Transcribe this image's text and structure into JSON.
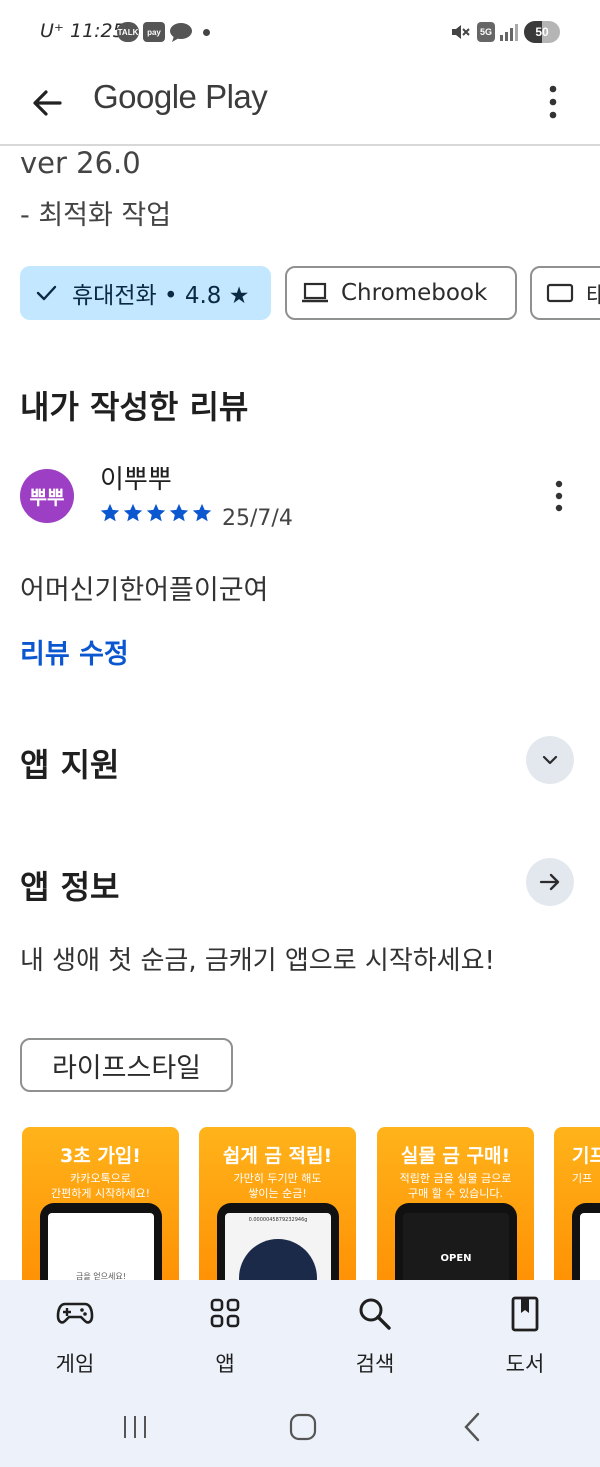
{
  "status_bar": {
    "carrier_time": "U⁺ 11:25",
    "notifications": [
      "TALK",
      "pay"
    ],
    "network": "5G",
    "battery": 50,
    "battery_label": "50"
  },
  "app_bar": {
    "title": "Google Play"
  },
  "whats_new": {
    "version": "ver 26.0",
    "note": "- 최적화 작업"
  },
  "device_chips": [
    {
      "label": "휴대전화 • 4.8 ★",
      "selected": true
    },
    {
      "label": "Chromebook",
      "selected": false
    },
    {
      "label": "태",
      "selected": false
    }
  ],
  "my_review": {
    "heading": "내가 작성한 리뷰",
    "avatar_text": "뿌뿌",
    "user_name": "이뿌뿌",
    "rating": 5,
    "date": "25/7/4",
    "text": "어머신기한어플이군여",
    "edit_link": "리뷰 수정"
  },
  "app_support": {
    "heading": "앱 지원"
  },
  "app_info": {
    "heading": "앱 정보",
    "description": "내 생애 첫 순금, 금캐기 앱으로 시작하세요!",
    "tag": "라이프스타일"
  },
  "screenshots": [
    {
      "title": "3초 가입!",
      "line1": "카카오톡으로",
      "line2": "간편하게 시작하세요!",
      "screen_text": "금을 얻으세요!"
    },
    {
      "title": "쉽게 금 적립!",
      "line1": "가만히 두기만 해도",
      "line2": "쌓이는 순금!",
      "screen_text": "0.0000045879232946g"
    },
    {
      "title": "실물 금 구매!",
      "line1": "적립한 금을 실물 금으로",
      "line2": "구매 할 수 있습니다.",
      "screen_text": "OPEN"
    },
    {
      "title": "기프",
      "line1": "기프",
      "line2": "",
      "screen_text": ""
    }
  ],
  "bottom_nav": [
    {
      "label": "게임",
      "icon": "gamepad-icon"
    },
    {
      "label": "앱",
      "icon": "apps-grid-icon"
    },
    {
      "label": "검색",
      "icon": "search-icon"
    },
    {
      "label": "도서",
      "icon": "book-icon"
    }
  ],
  "colors": {
    "accent_blue": "#0b57d0",
    "chip_selected_bg": "#c2e7ff",
    "star": "#0b57d0",
    "avatar_bg": "#9c3fc4",
    "nav_bg": "#edf1f9"
  }
}
